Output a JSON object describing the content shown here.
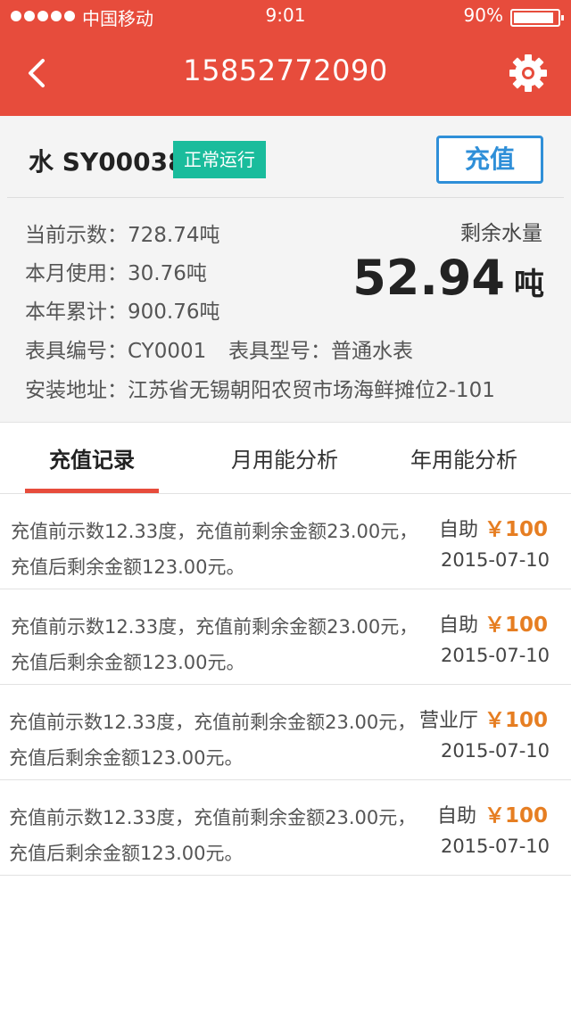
{
  "status_bar": {
    "carrier": "中国移动",
    "time": "9:01",
    "battery": "90%"
  },
  "header": {
    "title": "15852772090",
    "back_icon": "chevron-left-icon",
    "settings_icon": "gear-icon"
  },
  "meter": {
    "name": "水 SY00038",
    "status": "正常运行",
    "recharge_label": "充值",
    "current_reading": "当前示数：728.74吨",
    "month_usage": "本月使用：30.76吨",
    "year_total": "本年累计：900.76吨",
    "meter_number": "表具编号：CY0001",
    "meter_type": "表具型号：普通水表",
    "address": "安装地址：江苏省无锡朝阳农贸市场海鲜摊位2-101",
    "remaining_label": "剩余水量",
    "remaining_value": "52.94",
    "remaining_unit": "吨"
  },
  "tabs": [
    {
      "label": "充值记录",
      "active": true
    },
    {
      "label": "月用能分析",
      "active": false
    },
    {
      "label": "年用能分析",
      "active": false
    }
  ],
  "records": [
    {
      "desc": "充值前示数12.33度，充值前剩余金额23.00元，充值后剩余金额123.00元。",
      "channel": "自助",
      "amount": "￥100",
      "date": "2015-07-10"
    },
    {
      "desc": "充值前示数12.33度，充值前剩余金额23.00元，充值后剩余金额123.00元。",
      "channel": "自助",
      "amount": "￥100",
      "date": "2015-07-10"
    },
    {
      "desc": "充值前示数12.33度，充值前剩余金额23.00元，充值后剩余金额123.00元。",
      "channel": "营业厅",
      "amount": "￥100",
      "date": "2015-07-10"
    },
    {
      "desc": "充值前示数12.33度，充值前剩余金额23.00元，充值后剩余金额123.00元。",
      "channel": "自助",
      "amount": "￥100",
      "date": "2015-07-10"
    }
  ],
  "colors": {
    "header": "#e74c3c",
    "status_badge": "#1abc9c",
    "recharge_button": "#2f8fd8",
    "amount": "#e67e22"
  }
}
